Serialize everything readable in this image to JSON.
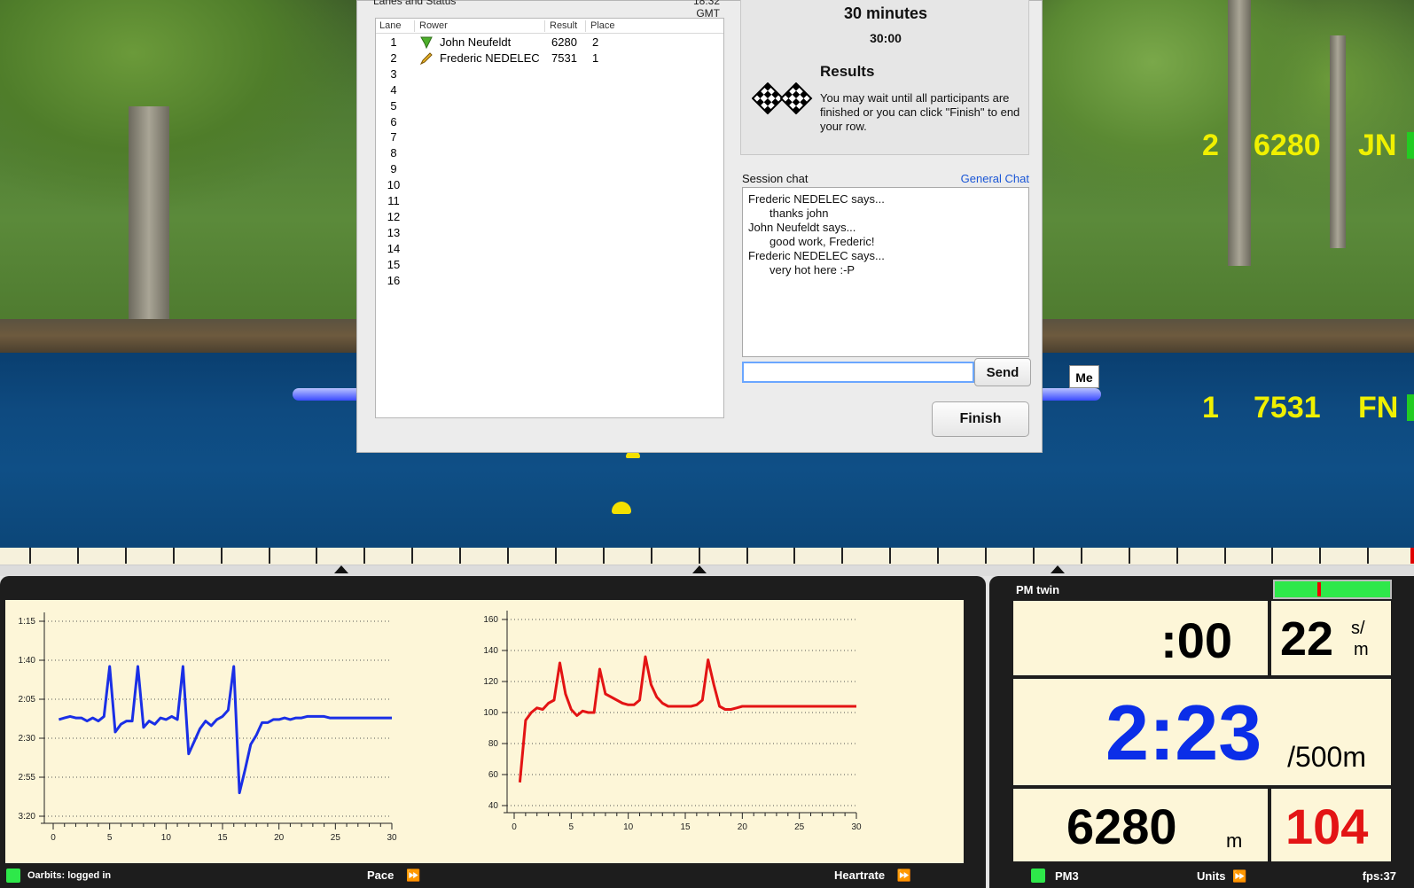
{
  "lanes": {
    "title": "Lanes and Status",
    "time": "18:32 GMT",
    "headers": {
      "lane": "Lane",
      "rower": "Rower",
      "result": "Result",
      "place": "Place"
    },
    "lane_numbers": [
      "1",
      "2",
      "3",
      "4",
      "5",
      "6",
      "7",
      "8",
      "9",
      "10",
      "11",
      "12",
      "13",
      "14",
      "15",
      "16"
    ],
    "rows": [
      {
        "name": "John Neufeldt",
        "result": "6280",
        "place": "2",
        "icon": "trophy-icon"
      },
      {
        "name": "Frederic NEDELEC",
        "result": "7531",
        "place": "1",
        "icon": "pencil-icon"
      }
    ]
  },
  "session": {
    "title": "30 minutes",
    "time": "30:00",
    "results_title": "Results",
    "results_text": "You may wait until all participants are finished or you can click \"Finish\" to end your row."
  },
  "chat": {
    "label": "Session chat",
    "link": "General Chat",
    "messages": [
      {
        "who": "Frederic NEDELEC says...",
        "text": "thanks john"
      },
      {
        "who": "John Neufeldt says...",
        "text": "good work, Frederic!"
      },
      {
        "who": "Frederic NEDELEC says...",
        "text": "very hot here :-P"
      }
    ],
    "input_value": "",
    "send_label": "Send"
  },
  "finish_label": "Finish",
  "scene": {
    "me_tag": "Me",
    "rows": [
      {
        "place": "2",
        "distance": "6280",
        "initials": "JN"
      },
      {
        "place": "1",
        "distance": "7531",
        "initials": "FN"
      }
    ]
  },
  "colors": {
    "pace_line": "#1a2fe6",
    "hr_line": "#e31414",
    "hud_yellow": "#f0f000",
    "accent_green": "#2ee84a"
  },
  "chart_data": [
    {
      "type": "line",
      "title": "",
      "xlabel": "",
      "ylabel": "",
      "xlim": [
        0,
        30
      ],
      "x_ticks": [
        "0",
        "5",
        "10",
        "15",
        "20",
        "25",
        "30"
      ],
      "y_ticks": [
        "1:15",
        "1:40",
        "2:05",
        "2:30",
        "2:55",
        "3:20"
      ],
      "y_reversed": true,
      "grid": true,
      "series": [
        {
          "x": [
            0.5,
            1,
            1.5,
            2,
            2.5,
            3,
            3.5,
            4,
            4.5,
            5,
            5.5,
            6,
            6.5,
            7,
            7.5,
            8,
            8.5,
            9,
            9.5,
            10,
            10.5,
            11,
            11.5,
            12,
            12.5,
            13,
            13.5,
            14,
            14.5,
            15,
            15.5,
            16,
            16.5,
            17,
            17.5,
            18,
            18.5,
            19,
            19.5,
            20,
            20.5,
            21,
            21.5,
            22,
            22.5,
            23,
            23.5,
            24,
            24.5,
            25,
            25.5,
            26,
            26.5,
            27,
            27.5,
            28,
            28.5,
            29,
            29.5,
            30
          ],
          "y": [
            138,
            137,
            136,
            137,
            137,
            139,
            137,
            139,
            136,
            104,
            146,
            141,
            139,
            139,
            104,
            143,
            139,
            141,
            137,
            138,
            136,
            138,
            104,
            160,
            152,
            144,
            139,
            142,
            138,
            136,
            132,
            104,
            185,
            170,
            154,
            148,
            140,
            140,
            138,
            138,
            137,
            138,
            137,
            137,
            136,
            136,
            136,
            136,
            137,
            137,
            137,
            137,
            137,
            137,
            137,
            137,
            137,
            137,
            137,
            137
          ]
        }
      ]
    },
    {
      "type": "line",
      "title": "",
      "xlabel": "",
      "ylabel": "",
      "xlim": [
        0,
        30
      ],
      "ylim": [
        40,
        160
      ],
      "x_ticks": [
        "0",
        "5",
        "10",
        "15",
        "20",
        "25",
        "30"
      ],
      "y_ticks": [
        "160",
        "140",
        "120",
        "100",
        "80",
        "60",
        "40"
      ],
      "grid": true,
      "series": [
        {
          "x": [
            0.5,
            1,
            1.5,
            2,
            2.5,
            3,
            3.5,
            4,
            4.5,
            5,
            5.5,
            6,
            6.5,
            7,
            7.5,
            8,
            8.5,
            9,
            9.5,
            10,
            10.5,
            11,
            11.5,
            12,
            12.5,
            13,
            13.5,
            14,
            14.5,
            15,
            15.5,
            16,
            16.5,
            17,
            17.5,
            18,
            18.5,
            19,
            19.5,
            20,
            20.5,
            21,
            21.5,
            22,
            22.5,
            23,
            23.5,
            24,
            24.5,
            25,
            25.5,
            26,
            26.5,
            27,
            27.5,
            28,
            28.5,
            29,
            29.5,
            30
          ],
          "y": [
            55,
            95,
            100,
            103,
            102,
            106,
            108,
            132,
            112,
            102,
            98,
            101,
            100,
            100,
            128,
            112,
            110,
            108,
            106,
            105,
            105,
            108,
            136,
            118,
            110,
            106,
            104,
            104,
            104,
            104,
            104,
            105,
            108,
            134,
            118,
            104,
            102,
            102,
            103,
            104,
            104,
            104,
            104,
            104,
            104,
            104,
            104,
            104,
            104,
            104,
            104,
            104,
            104,
            104,
            104,
            104,
            104,
            104,
            104,
            104
          ]
        }
      ]
    }
  ],
  "graph_footer": {
    "status": "Oarbits: logged in",
    "pace_label": "Pace",
    "hr_label": "Heartrate"
  },
  "pm": {
    "title": "PM twin",
    "time": ":00",
    "stroke_rate": "22",
    "stroke_unit_top": "s/",
    "stroke_unit_bottom": "m",
    "pace": "2:23",
    "pace_unit": "/500m",
    "distance": "6280",
    "distance_unit": "m",
    "heartrate": "104",
    "footer_pm": "PM3",
    "footer_units": "Units",
    "footer_fps": "fps:37"
  }
}
